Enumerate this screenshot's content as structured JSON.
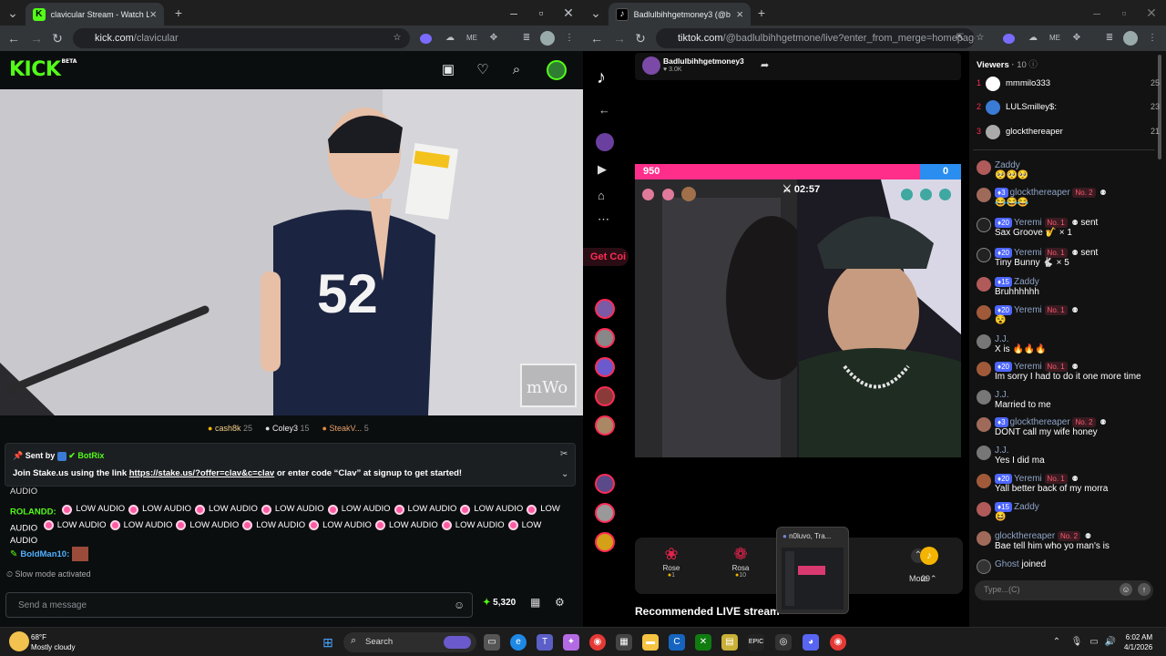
{
  "left_browser": {
    "tab_title": "clavicular Stream - Watch Live o",
    "url_host": "kick.com",
    "url_path": "/clavicular",
    "kick": {
      "logo": "KICK",
      "logo_sup": "BETA",
      "top_gifters": [
        {
          "name": "cash8k",
          "count": "25"
        },
        {
          "name": "Coley3",
          "count": "15"
        },
        {
          "name": "SteakV...",
          "count": "5"
        }
      ],
      "pinned": {
        "sent_by_label": "Sent by",
        "sender": "BotRix",
        "message_before": "Join Stake.us using the link ",
        "link": "https://stake.us/?offer=clav&c=clav",
        "message_after": " or enter code “Clav” at signup to get started!"
      },
      "chat": {
        "overflow_text": "AUDIO",
        "roland_name": "ROLANDD:",
        "low_audio_line1": [
          "LOW AUDIO",
          "LOW AUDIO",
          "LOW AUDIO",
          "LOW AUDIO",
          "LOW AUDIO",
          "LOW AUDIO",
          "LOW AUDIO",
          "LOW"
        ],
        "low_audio_line2_first": "AUDIO",
        "low_audio_line2": [
          "LOW AUDIO",
          "LOW AUDIO",
          "LOW AUDIO",
          "LOW AUDIO",
          "LOW AUDIO",
          "LOW AUDIO",
          "LOW AUDIO",
          "LOW"
        ],
        "low_audio_line3": "AUDIO",
        "boldman_name": "BoldMan10:",
        "slow_mode": "Slow mode activated",
        "input_placeholder": "Send a message",
        "points": "5,320"
      }
    }
  },
  "right_browser": {
    "tab_title": "Badlulbihhgetmoney3 (@b",
    "url_host": "tiktok.com",
    "url_path": "/@badlulbihhgetmone/live?enter_from_merge=homepage...",
    "host_name": "Badlulbihhgetmoney3",
    "host_likes": "3.0K",
    "battle": {
      "left_score": "950",
      "right_score": "0",
      "timer": "02:57"
    },
    "get_coins": "Get Coi",
    "gifts": [
      {
        "name": "Rose",
        "price": "1"
      },
      {
        "name": "Rosa",
        "price": "10"
      }
    ],
    "more_label": "More",
    "coins_label": "29",
    "recommended": "Recommended LIVE stream",
    "popup_title": "n0luvo, Tra...",
    "viewers": {
      "title": "Viewers",
      "count": "10",
      "list": [
        {
          "rank": "1",
          "name": "mmmilo333",
          "score": "25"
        },
        {
          "rank": "2",
          "name": "LULSmilley$:",
          "score": "23"
        },
        {
          "rank": "3",
          "name": "glockthereaper",
          "score": "21"
        }
      ]
    },
    "chat": [
      {
        "name": "Zaddy",
        "text": "🥺🥺🥺"
      },
      {
        "lvl": "3",
        "name": "glockthereaper",
        "no": "No. 2",
        "text": "😂😂😂"
      },
      {
        "lvl": "20",
        "name": "Yeremi",
        "no": "No. 1",
        "sent": "sent",
        "text": "Sax Groove 🎷 × 1"
      },
      {
        "lvl": "20",
        "name": "Yeremi",
        "no": "No. 1",
        "sent": "sent",
        "text": "Tiny Bunny 🐇 × 5"
      },
      {
        "lvl": "15",
        "name": "Zaddy",
        "text": "Bruhhhhhh"
      },
      {
        "lvl": "20",
        "name": "Yeremi",
        "no": "No. 1",
        "text": "😵"
      },
      {
        "name": "J.J.",
        "text": "X is 🔥🔥🔥"
      },
      {
        "lvl": "20",
        "name": "Yeremi",
        "no": "No. 1",
        "text": "Im sorry I had to do it one more time"
      },
      {
        "name": "J.J.",
        "text": "Married to me"
      },
      {
        "lvl": "3",
        "name": "glockthereaper",
        "no": "No. 2",
        "text": "DONT call my wife honey"
      },
      {
        "name": "J.J.",
        "text": "Yes I did ma"
      },
      {
        "lvl": "20",
        "name": "Yeremi",
        "no": "No. 1",
        "text": "Yall better back of my morra"
      },
      {
        "lvl": "15",
        "name": "Zaddy",
        "text": "😆"
      },
      {
        "name": "glockthereaper",
        "no": "No. 2",
        "text": "Bae tell him who yo man's is"
      },
      {
        "name": "Ghost",
        "text": "joined"
      }
    ],
    "chat_input_placeholder": "Type...(C)"
  },
  "taskbar": {
    "weather_temp": "68°F",
    "weather_desc": "Mostly cloudy",
    "search_label": "Search",
    "time": "6:02 AM",
    "date": "4/1/2026"
  },
  "colors": {
    "kick_green": "#53fc18",
    "tiktok_pink": "#fe2c55",
    "chrome_dark": "#202124"
  }
}
